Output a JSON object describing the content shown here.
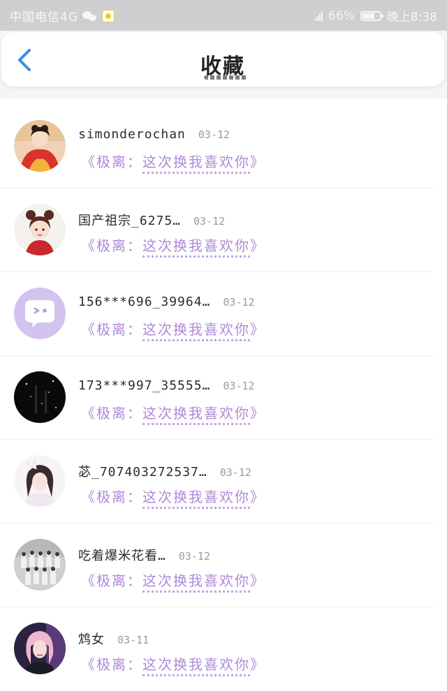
{
  "status_bar": {
    "carrier": "中国电信4G",
    "network": "4G",
    "battery": "66%",
    "time": "晚上8:38"
  },
  "header": {
    "back_icon": "chevron-left-icon",
    "title": "收藏"
  },
  "favorites": [
    {
      "user": "simonderochan",
      "date": "03-12",
      "prefix": "《极离：",
      "book": "这次换我喜欢你",
      "suffix": "》",
      "avatar": "girl-red-dress"
    },
    {
      "user": "国产祖宗_6275…",
      "date": "03-12",
      "prefix": "《极离：",
      "book": "这次换我喜欢你",
      "suffix": "》",
      "avatar": "cartoon-girl-buns"
    },
    {
      "user": "156***696_39964…",
      "date": "03-12",
      "prefix": "《极离：",
      "book": "这次换我喜欢你",
      "suffix": "》",
      "avatar": "default-chat-bubble"
    },
    {
      "user": "173***997_35555…",
      "date": "03-12",
      "prefix": "《极离：",
      "book": "这次换我喜欢你",
      "suffix": "》",
      "avatar": "night-scene"
    },
    {
      "user": "苾_707403272537…",
      "date": "03-12",
      "prefix": "《极离：",
      "book": "这次换我喜欢你",
      "suffix": "》",
      "avatar": "girl-white-bow"
    },
    {
      "user": "吃着爆米花看…",
      "date": "03-12",
      "prefix": "《极离：",
      "book": "这次换我喜欢你",
      "suffix": "》",
      "avatar": "group-photo"
    },
    {
      "user": "鸩女",
      "date": "03-11",
      "prefix": "《极离：",
      "book": "这次换我喜欢你",
      "suffix": "》",
      "avatar": "girl-pink-hair"
    }
  ],
  "colors": {
    "link": "#b088d8",
    "status_bar": "#cfcfd1",
    "back_icon": "#3a8ee6"
  }
}
